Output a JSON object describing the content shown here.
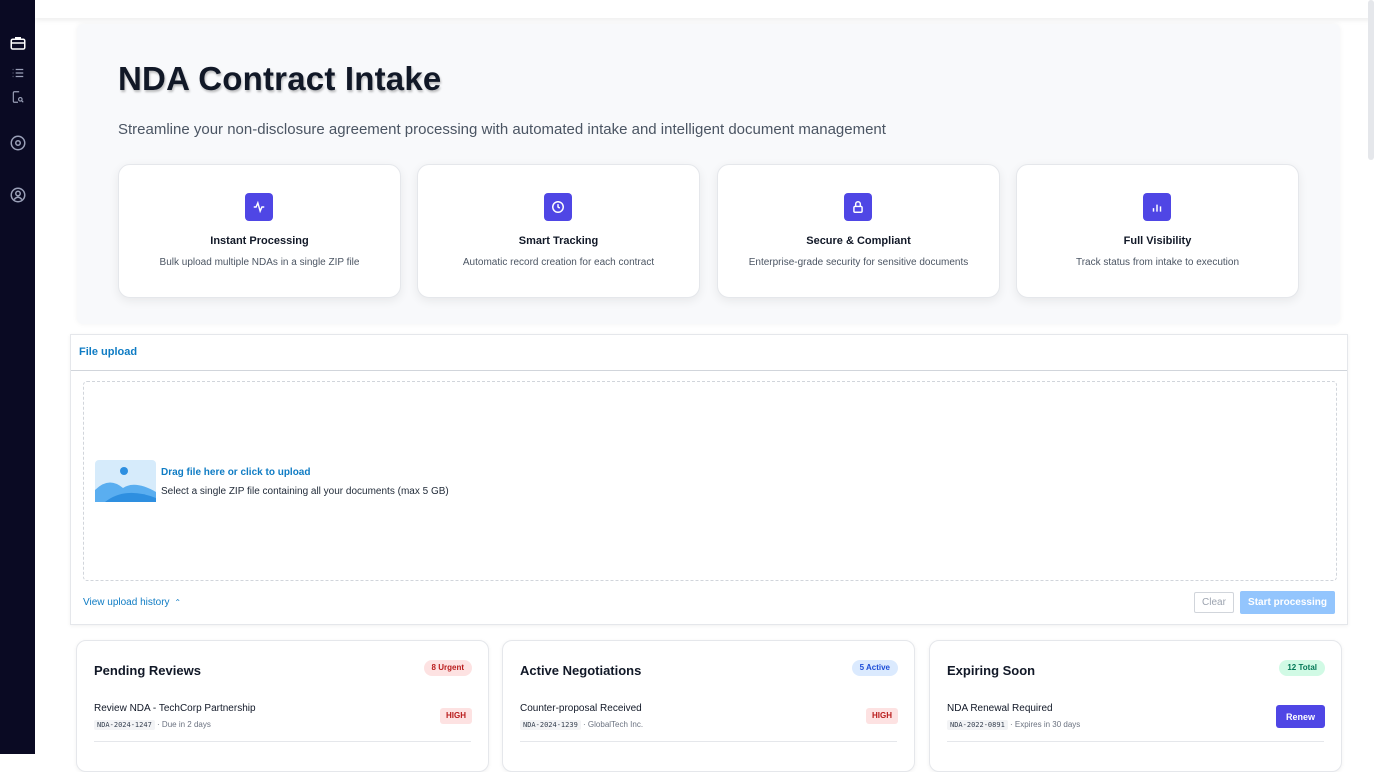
{
  "hero": {
    "title": "NDA Contract Intake",
    "subtitle": "Streamline your non-disclosure agreement processing with automated intake and intelligent document management",
    "features": [
      {
        "icon": "activity-icon",
        "title": "Instant Processing",
        "desc": "Bulk upload multiple NDAs in a single ZIP file"
      },
      {
        "icon": "clock-icon",
        "title": "Smart Tracking",
        "desc": "Automatic record creation for each contract"
      },
      {
        "icon": "lock-icon",
        "title": "Secure & Compliant",
        "desc": "Enterprise-grade security for sensitive documents"
      },
      {
        "icon": "bar-chart-icon",
        "title": "Full Visibility",
        "desc": "Track status from intake to execution"
      }
    ]
  },
  "upload": {
    "tab_label": "File upload",
    "drop_title": "Drag file here or click to upload",
    "drop_desc": "Select a single ZIP file containing all your documents (max 5 GB)",
    "history_label": "View upload history",
    "clear_label": "Clear",
    "start_label": "Start processing"
  },
  "cards": [
    {
      "title": "Pending Reviews",
      "badge": "8 Urgent",
      "badge_bg": "#fde2e2",
      "badge_fg": "#b91c1c",
      "item": {
        "title": "Review NDA - TechCorp Partnership",
        "code": "NDA-2024-1247",
        "meta": "· Due in 2 days",
        "priority": "HIGH"
      }
    },
    {
      "title": "Active Negotiations",
      "badge": "5 Active",
      "badge_bg": "#dbeafe",
      "badge_fg": "#1d4ed8",
      "item": {
        "title": "Counter-proposal Received",
        "code": "NDA-2024-1239",
        "meta": "· GlobalTech Inc.",
        "priority": "HIGH"
      }
    },
    {
      "title": "Expiring Soon",
      "badge": "12 Total",
      "badge_bg": "#d1fae5",
      "badge_fg": "#047857",
      "item": {
        "title": "NDA Renewal Required",
        "code": "NDA-2022-0891",
        "meta": "· Expires in 30 days",
        "action": "Renew"
      }
    }
  ],
  "colors": {
    "accent": "#4f46e5",
    "link": "#0f7cc4",
    "rail": "#0a0a23"
  }
}
